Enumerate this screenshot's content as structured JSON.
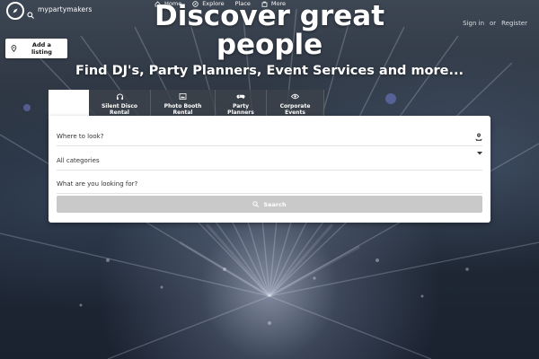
{
  "header": {
    "brand": "mypartymakers",
    "nav": [
      "Home",
      "Explore",
      "Place",
      "More"
    ],
    "sign_in": "Sign in",
    "or": "or",
    "register": "Register",
    "add_listing": "Add a listing"
  },
  "hero": {
    "title_line1": "Discover great",
    "title_line2": "people",
    "subtitle": "Find DJ's, Party Planners, Event Services and more..."
  },
  "tabs": [
    {
      "label": "",
      "icon": "blank"
    },
    {
      "label": "Silent Disco Rental",
      "icon": "headphones-icon"
    },
    {
      "label": "Photo Booth Rental",
      "icon": "photo-icon"
    },
    {
      "label": "Party Planners",
      "icon": "gamepad-icon"
    },
    {
      "label": "Corporate Events",
      "icon": "eye-icon"
    }
  ],
  "search": {
    "location_placeholder": "Where to look?",
    "category_value": "All categories",
    "keyword_placeholder": "What are you looking for?",
    "button_label": "Search"
  },
  "colors": {
    "search_button": "#c9c9c9",
    "panel": "#ffffff",
    "tab_bg": "#3c424a"
  }
}
